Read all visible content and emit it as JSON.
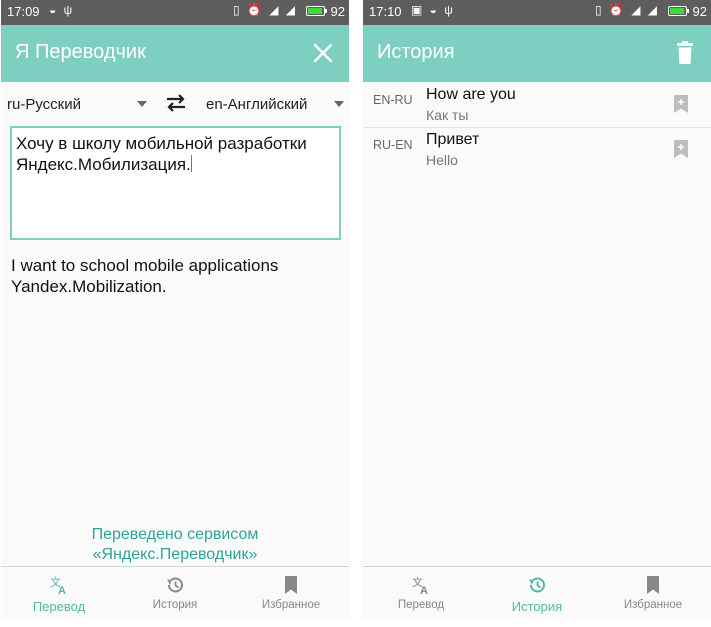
{
  "colors": {
    "accent": "#7dcfc1",
    "accent_text": "#2ba597",
    "statusbar": "#5d5d5d",
    "battery": "#3ddc3d"
  },
  "left": {
    "status": {
      "time": "17:09",
      "battery": "92"
    },
    "appbar": {
      "title": "Я Переводчик",
      "action_icon": "close-icon"
    },
    "langs": {
      "source": "ru-Русский",
      "target": "en-Английский",
      "swap_icon": "swap-arrows-icon"
    },
    "input": {
      "text": "Хочу в школу мобильной разработки Яндекс.Мобилизация."
    },
    "output": {
      "text": "I want to school mobile applications Yandex.Mobilization."
    },
    "credit": {
      "line1": "Переведено сервисом",
      "line2": "«Яндекс.Переводчик»"
    },
    "nav": [
      {
        "label": "Перевод",
        "icon": "translate-icon",
        "active": true
      },
      {
        "label": "История",
        "icon": "history-icon",
        "active": false
      },
      {
        "label": "Избранное",
        "icon": "bookmark-icon",
        "active": false
      }
    ]
  },
  "right": {
    "status": {
      "time": "17:10",
      "battery": "92"
    },
    "appbar": {
      "title": "История",
      "action_icon": "trash-icon"
    },
    "history": [
      {
        "direction": "EN-RU",
        "source": "How are you",
        "translation": "Как ты"
      },
      {
        "direction": "RU-EN",
        "source": "Привет",
        "translation": "Hello"
      }
    ],
    "nav": [
      {
        "label": "Перевод",
        "icon": "translate-icon",
        "active": false
      },
      {
        "label": "История",
        "icon": "history-icon",
        "active": true
      },
      {
        "label": "Избранное",
        "icon": "bookmark-icon",
        "active": false
      }
    ]
  }
}
